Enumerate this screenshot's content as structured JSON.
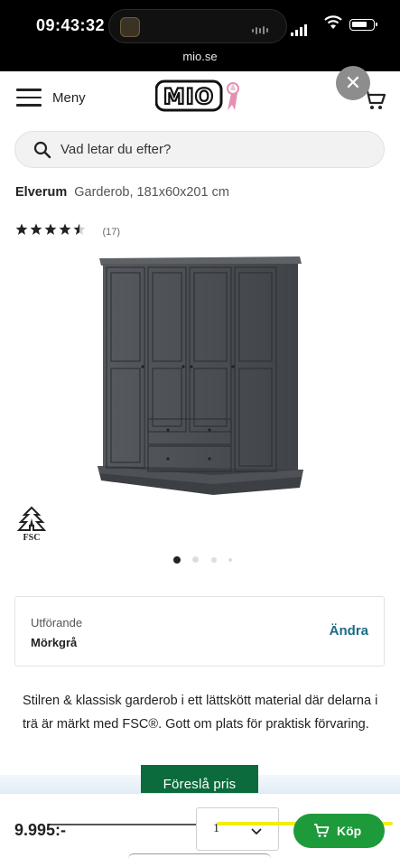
{
  "status_bar": {
    "time": "09:43:32"
  },
  "browser": {
    "url": "mio.se"
  },
  "header": {
    "menu_label": "Meny",
    "logo_text": "MIO",
    "close_symbol": "✕"
  },
  "search": {
    "placeholder": "Vad letar du efter?"
  },
  "product": {
    "brand": "Elverum",
    "name": "Garderob, 181x60x201 cm",
    "rating": {
      "stars": 4.5,
      "count_label": "(17)"
    },
    "fsc_label": "FSC",
    "gallery": {
      "count": 4,
      "active_index": 0
    },
    "variant": {
      "label": "Utförande",
      "value": "Mörkgrå",
      "change_label": "Ändra"
    },
    "description": "Stilren & klassisk garderob i ett lättskött material där delarna i trä är märkt med FSC®. Gott om plats för praktisk förvaring."
  },
  "actions": {
    "suggest_price_label": "Föreslå pris",
    "price": "9.995:-",
    "quantity": "1",
    "buy_label": "Köp"
  },
  "colors": {
    "accent_green": "#0b6b3d",
    "buy_green": "#1d9a3a",
    "link_blue": "#1c6a88",
    "logo_pink": "#e58fb5"
  },
  "icons": [
    "menu-icon",
    "search-icon",
    "cart-icon",
    "star-icon",
    "fsc-tree-icon",
    "chevron-down-icon",
    "close-icon"
  ]
}
